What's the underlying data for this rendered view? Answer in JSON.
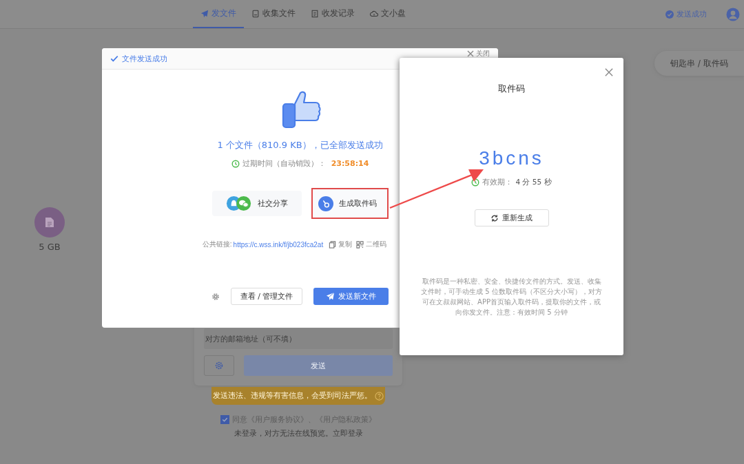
{
  "nav": {
    "tabs": [
      {
        "kind": "send",
        "label": "发文件",
        "selected": true
      },
      {
        "kind": "collect",
        "label": "收集文件",
        "selected": false
      },
      {
        "kind": "records",
        "label": "收发记录",
        "selected": false
      },
      {
        "kind": "disk",
        "label": "文小盘",
        "selected": false
      }
    ],
    "status": "发送成功"
  },
  "side_button": "钥匙串 / 取件码",
  "storage": {
    "label": "5 GB"
  },
  "send_form": {
    "email_placeholder": "对方的邮箱地址（可不填）",
    "send_button": "发送",
    "warning": "发送违法、违规等有害信息，会受到司法严惩。",
    "agreement": {
      "checked": true,
      "text": "同意《用户服务协议》、《用户隐私政策》"
    },
    "login_hint": "未登录，对方无法在线预览。立即登录"
  },
  "success_dialog": {
    "title": "文件发送成功",
    "close_label": "关闭",
    "summary": "1 个文件（810.9 KB），已全部发送成功",
    "expiry_label": "过期时间（自动销毁）：",
    "expiry_time": "23:58:14",
    "actions": [
      {
        "kind": "share",
        "label": "社交分享",
        "highlighted": false
      },
      {
        "kind": "code",
        "label": "生成取件码",
        "highlighted": true
      }
    ],
    "link_label": "公共链接:",
    "link_url": "https://c.wss.ink/f/jb023fca2at",
    "copy_label": "复制",
    "qr_label": "二维码",
    "manage_button": "查看 / 管理文件",
    "new_button": "发送新文件"
  },
  "code_dialog": {
    "title": "取件码",
    "code": "3bcns",
    "validity_label": "有效期：",
    "validity": "4 分 55 秒",
    "regenerate_button": "重新生成",
    "description": "取件码是一种私密、安全、快捷传文件的方式。发送、收集文件时，可手动生成 5 位数取件码（不区分大小写），对方可在文叔叔网站、APP首页输入取件码，提取你的文件，或向你发文件。注意：有效时间 5 分钟"
  }
}
